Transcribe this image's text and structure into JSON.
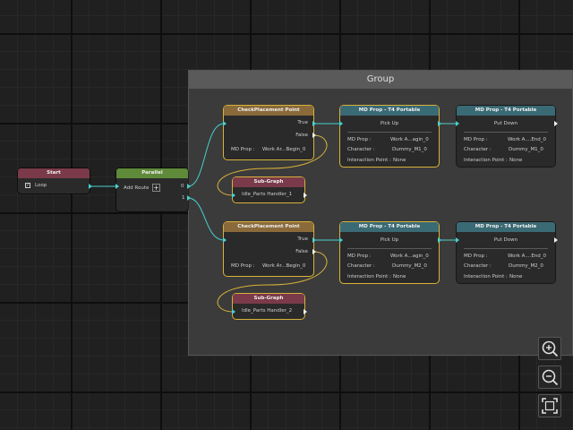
{
  "group": {
    "title": "Group"
  },
  "start_node": {
    "title": "Start",
    "loop_label": "Loop",
    "loop_checked": true
  },
  "parallel_node": {
    "title": "Parallel",
    "add_route_label": "Add Route",
    "add_icon": "plus-icon",
    "outputs": [
      "0",
      "1"
    ]
  },
  "check_nodes": [
    {
      "title": "CheckPlacement Point",
      "true_label": "True",
      "false_label": "False",
      "prop_label": "MD Prop :",
      "prop_value": "Work Ar...Begin_0"
    },
    {
      "title": "CheckPlacement Point",
      "true_label": "True",
      "false_label": "False",
      "prop_label": "MD Prop :",
      "prop_value": "Work Ar...Begin_0"
    }
  ],
  "subgraph_nodes": [
    {
      "title": "Sub-Graph",
      "value": "Idle_Parts Handler_1"
    },
    {
      "title": "Sub-Graph",
      "value": "Idle_Parts Handler_2"
    }
  ],
  "prop_nodes": [
    {
      "title": "MD Prop - T4 Portable",
      "action": "Pick Up",
      "prop_label": "MD Prop :",
      "prop_value": "Work A...agin_0",
      "char_label": "Character :",
      "char_value": "Dummy_M1_0",
      "ip_label": "Interaction Point :",
      "ip_value": "None"
    },
    {
      "title": "MD Prop - T4 Portable",
      "action": "Put Down",
      "prop_label": "MD Prop :",
      "prop_value": "Work A....End_0",
      "char_label": "Character :",
      "char_value": "Dummy_M1_0",
      "ip_label": "Interaction Point :",
      "ip_value": "None"
    },
    {
      "title": "MD Prop - T4 Portable",
      "action": "Pick Up",
      "prop_label": "MD Prop :",
      "prop_value": "Work A...agin_0",
      "char_label": "Character :",
      "char_value": "Dummy_M2_0",
      "ip_label": "Interaction Point :",
      "ip_value": "None"
    },
    {
      "title": "MD Prop - T4 Portable",
      "action": "Put Down",
      "prop_label": "MD Prop :",
      "prop_value": "Work A....End_0",
      "char_label": "Character :",
      "char_value": "Dummy_M2_0",
      "ip_label": "Interaction Point :",
      "ip_value": "None"
    }
  ],
  "zoom_controls": [
    {
      "name": "zoom-in-button",
      "icon": "zoom-in-icon"
    },
    {
      "name": "zoom-out-button",
      "icon": "zoom-out-icon"
    },
    {
      "name": "fit-view-button",
      "icon": "fit-screen-icon"
    }
  ],
  "colors": {
    "start_header": "#7a3a4a",
    "parallel_header": "#5e8a3a",
    "check_header": "#8a6a3a",
    "subgraph_header": "#7a3a4a",
    "prop_header": "#3a6a74",
    "wire": "#48d1cc",
    "selection": "#d8b23a"
  }
}
